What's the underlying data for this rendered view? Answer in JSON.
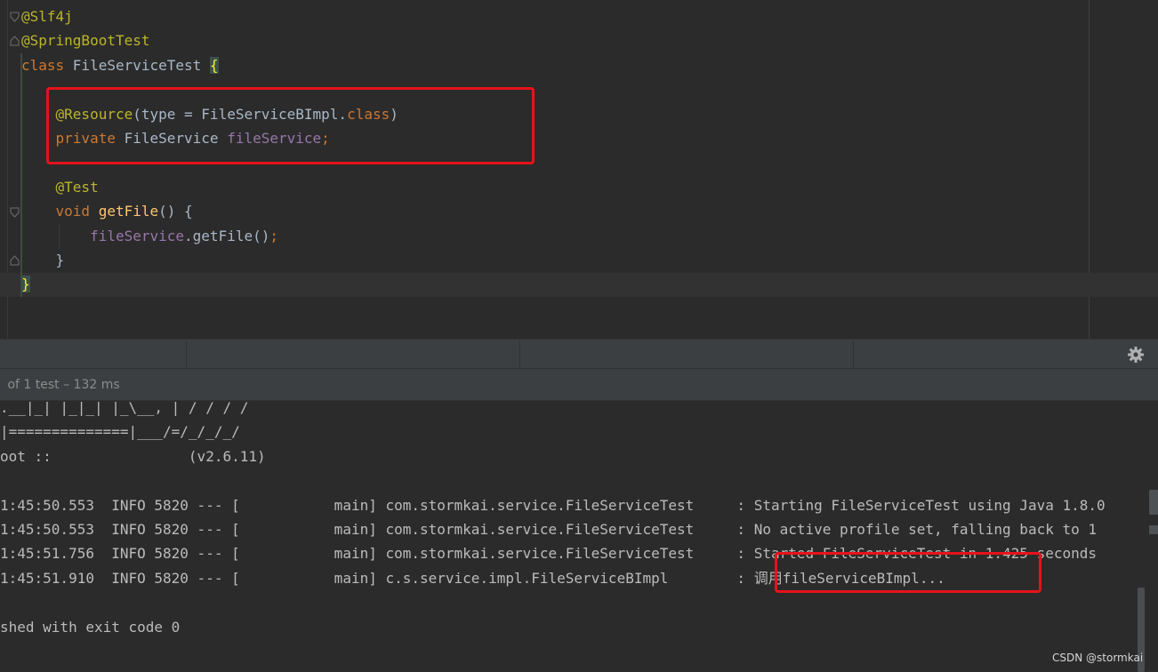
{
  "editor": {
    "lines": [
      {
        "parts": [
          {
            "t": "@Slf4j",
            "c": "ann"
          }
        ]
      },
      {
        "parts": [
          {
            "t": "@SpringBootTest",
            "c": "ann"
          }
        ]
      },
      {
        "parts": [
          {
            "t": "class ",
            "c": "kw"
          },
          {
            "t": "FileServiceTest ",
            "c": ""
          },
          {
            "t": "{",
            "c": "brace-hl"
          }
        ]
      },
      {
        "parts": []
      },
      {
        "parts": [
          {
            "t": "    ",
            "c": ""
          },
          {
            "t": "@Resource",
            "c": "ann"
          },
          {
            "t": "(type = FileServiceBImpl.",
            "c": ""
          },
          {
            "t": "class",
            "c": "kw"
          },
          {
            "t": ")",
            "c": ""
          }
        ]
      },
      {
        "parts": [
          {
            "t": "    ",
            "c": ""
          },
          {
            "t": "private ",
            "c": "kw"
          },
          {
            "t": "FileService ",
            "c": ""
          },
          {
            "t": "fileService",
            "c": "fld"
          },
          {
            "t": ";",
            "c": "kw"
          }
        ]
      },
      {
        "parts": []
      },
      {
        "parts": [
          {
            "t": "    ",
            "c": ""
          },
          {
            "t": "@Test",
            "c": "ann"
          }
        ]
      },
      {
        "parts": [
          {
            "t": "    ",
            "c": ""
          },
          {
            "t": "void ",
            "c": "kw"
          },
          {
            "t": "getFile",
            "c": "mth"
          },
          {
            "t": "() {",
            "c": ""
          }
        ]
      },
      {
        "parts": [
          {
            "t": "        ",
            "c": ""
          },
          {
            "t": "fileService",
            "c": "fld"
          },
          {
            "t": ".getFile()",
            "c": ""
          },
          {
            "t": ";",
            "c": "kw"
          }
        ]
      },
      {
        "parts": [
          {
            "t": "    }",
            "c": ""
          }
        ]
      },
      {
        "parts": [
          {
            "t": "}",
            "c": "brace-hl"
          }
        ]
      }
    ]
  },
  "run_panel": {
    "status_text": " of 1 test – 132 ms"
  },
  "console": {
    "lines": [
      ".__|_| |_|_| |_\\__, | / / / /",
      "|==============|___/=/_/_/_/",
      "oot ::                (v2.6.11)",
      "",
      "1:45:50.553  INFO 5820 --- [           main] com.stormkai.service.FileServiceTest     : Starting FileServiceTest using Java 1.8.0",
      "1:45:50.553  INFO 5820 --- [           main] com.stormkai.service.FileServiceTest     : No active profile set, falling back to 1",
      "1:45:51.756  INFO 5820 --- [           main] com.stormkai.service.FileServiceTest     : Started FileServiceTest in 1.425 seconds",
      "1:45:51.910  INFO 5820 --- [           main] c.s.service.impl.FileServiceBImpl        : 调用fileServiceBImpl...",
      "",
      "shed with exit code 0"
    ]
  },
  "watermark": "CSDN @stormkai",
  "icons": {
    "settings": "gear-icon",
    "fold": "fold-marker-icon"
  },
  "colors": {
    "annotation_box": "#e8121b"
  }
}
